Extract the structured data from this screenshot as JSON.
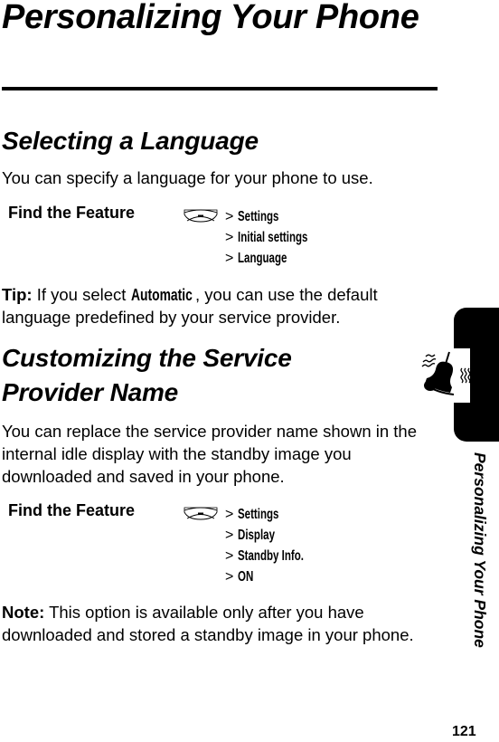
{
  "chapter": {
    "title": "Personalizing Your Phone"
  },
  "sections": [
    {
      "heading": "Selecting a Language",
      "intro": "You can specify a language for your phone to use.",
      "find_feature": {
        "label": "Find the Feature",
        "icon": "menu-key-icon",
        "path": [
          "Settings",
          "Initial settings",
          "Language"
        ]
      },
      "note": {
        "prefix": "Tip:",
        "before": " If you select ",
        "keyword": "Automatic",
        "after": ", you can use the default language predefined by your service provider."
      }
    },
    {
      "heading": "Customizing the Service Provider Name",
      "intro": "You can replace the service provider name shown in the internal idle display with the standby image you downloaded and saved in your phone.",
      "find_feature": {
        "label": "Find the Feature",
        "icon": "menu-key-icon",
        "path": [
          "Settings",
          "Display",
          "Standby Info.",
          "ON"
        ]
      },
      "note": {
        "prefix": "Note:",
        "text": " This option is available only after you have downloaded and stored a standby image in your phone."
      }
    }
  ],
  "side_tab": {
    "icon": "ringing-bell-icon",
    "label": "Personalizing Your Phone"
  },
  "page_number": "121",
  "path_separator": ">"
}
